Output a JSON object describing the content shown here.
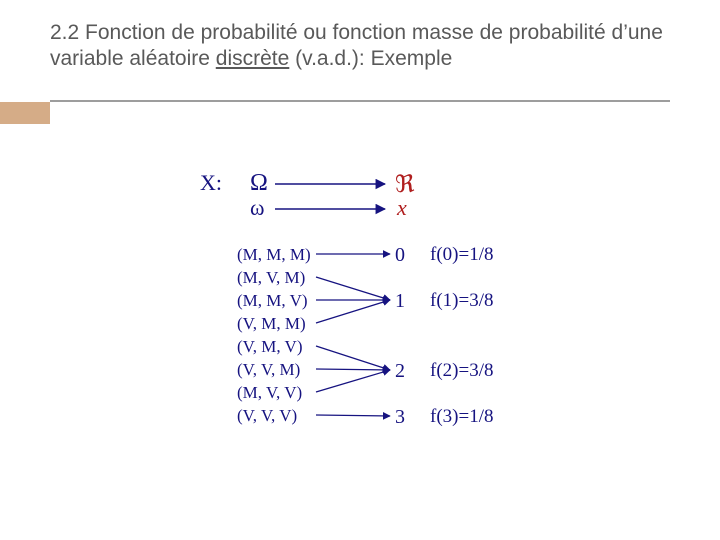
{
  "title": {
    "prefix": "2.2 Fonction de probabilité ou fonction masse de probabilité d’une variable aléatoire ",
    "underlined": "discrète",
    "suffix": " (v.a.d.): Exemple"
  },
  "body": {
    "Xlabel": "X:",
    "OmegaBig": "Ω",
    "omegaSmall": "ω",
    "realR": "ℜ",
    "x": "x"
  },
  "outcomes": [
    "(M, M, M)",
    "(M, V, M)",
    "(M, M, V)",
    "(V, M, M)",
    "(V, M, V)",
    "(V, V, M)",
    "(M, V, V)",
    "(V, V, V)"
  ],
  "values": {
    "v0": "0",
    "v1": "1",
    "v2": "2",
    "v3": "3"
  },
  "probs": {
    "f0": "f(0)=1/8",
    "f1": "f(1)=3/8",
    "f2": "f(2)=3/8",
    "f3": "f(3)=1/8"
  }
}
